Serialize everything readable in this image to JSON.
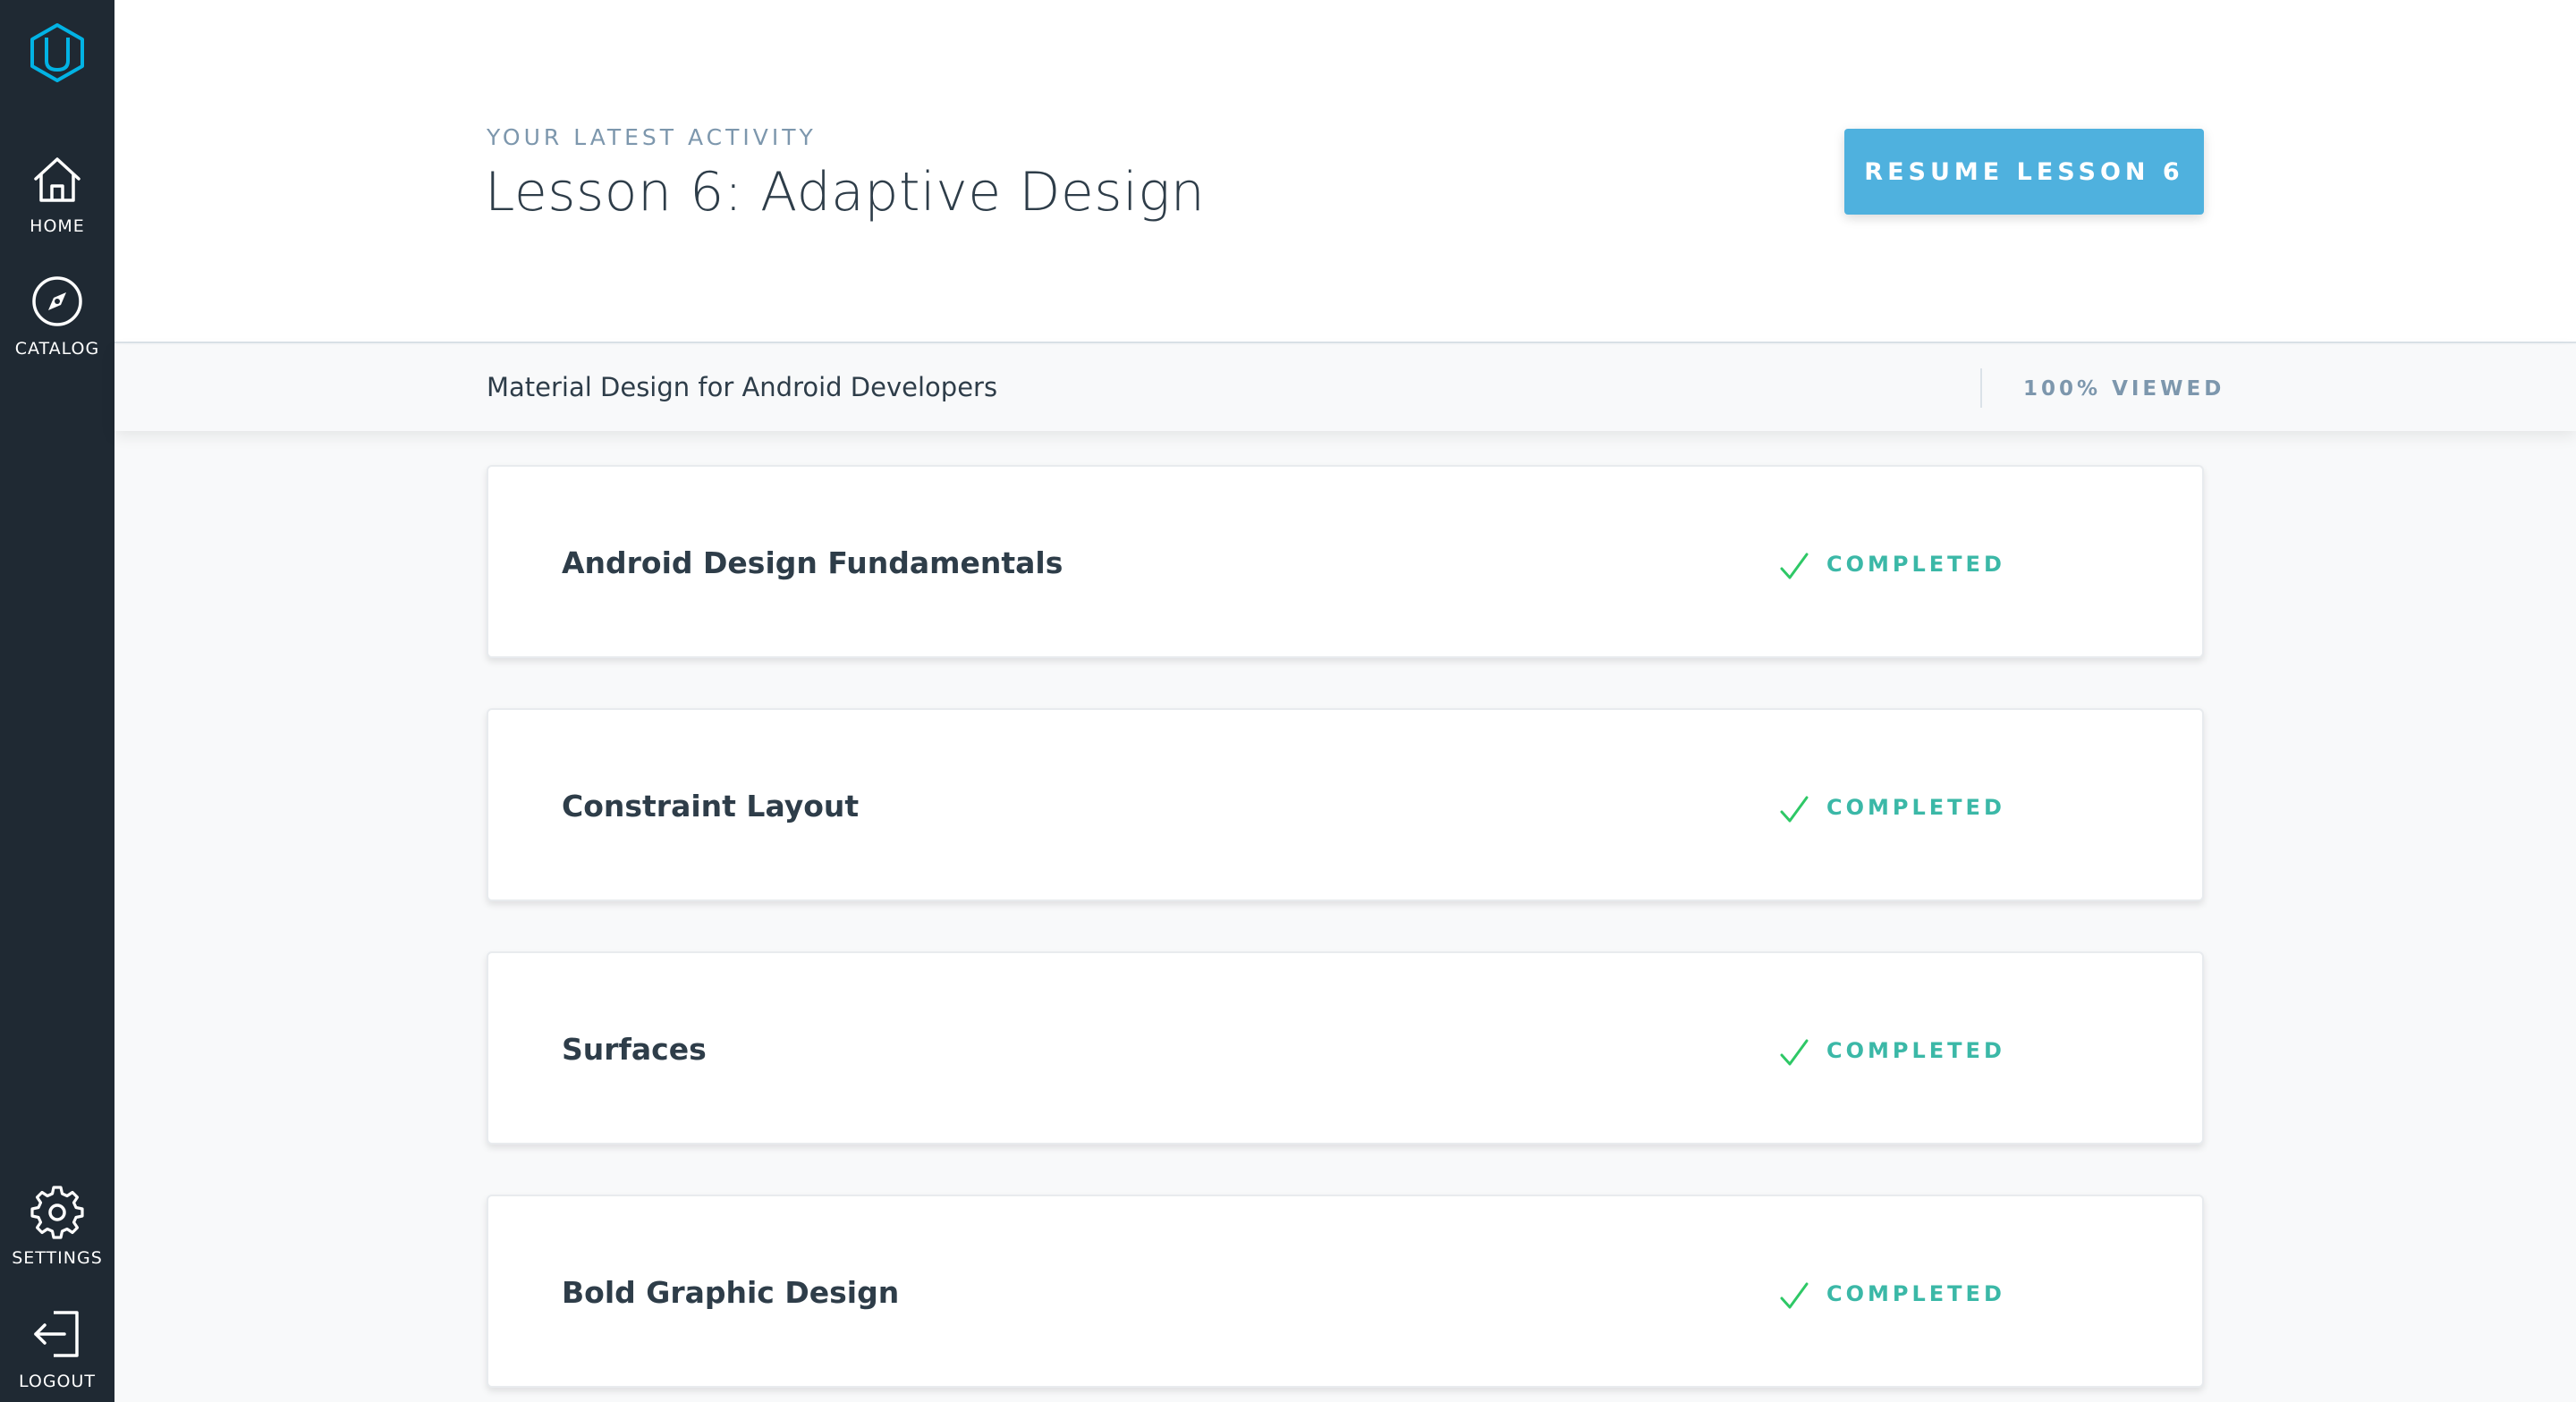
{
  "sidebar": {
    "logo": "udacity-logo",
    "items": [
      {
        "label": "HOME",
        "icon": "home-icon"
      },
      {
        "label": "CATALOG",
        "icon": "compass-icon"
      },
      {
        "label": "SETTINGS",
        "icon": "gear-icon"
      },
      {
        "label": "LOGOUT",
        "icon": "logout-icon"
      }
    ]
  },
  "header": {
    "eyebrow": "YOUR LATEST ACTIVITY",
    "title": "Lesson 6: Adaptive Design",
    "resume_label": "RESUME LESSON 6"
  },
  "subbar": {
    "course_name": "Material Design for Android Developers",
    "progress": "100% VIEWED"
  },
  "lessons": [
    {
      "title": "Android Design Fundamentals",
      "status": "COMPLETED"
    },
    {
      "title": "Constraint Layout",
      "status": "COMPLETED"
    },
    {
      "title": "Surfaces",
      "status": "COMPLETED"
    },
    {
      "title": "Bold Graphic Design",
      "status": "COMPLETED"
    }
  ],
  "colors": {
    "sidebar_bg": "#1f2933",
    "accent": "#4fb1de",
    "completed": "#3bb8a7",
    "check": "#2ec866"
  }
}
